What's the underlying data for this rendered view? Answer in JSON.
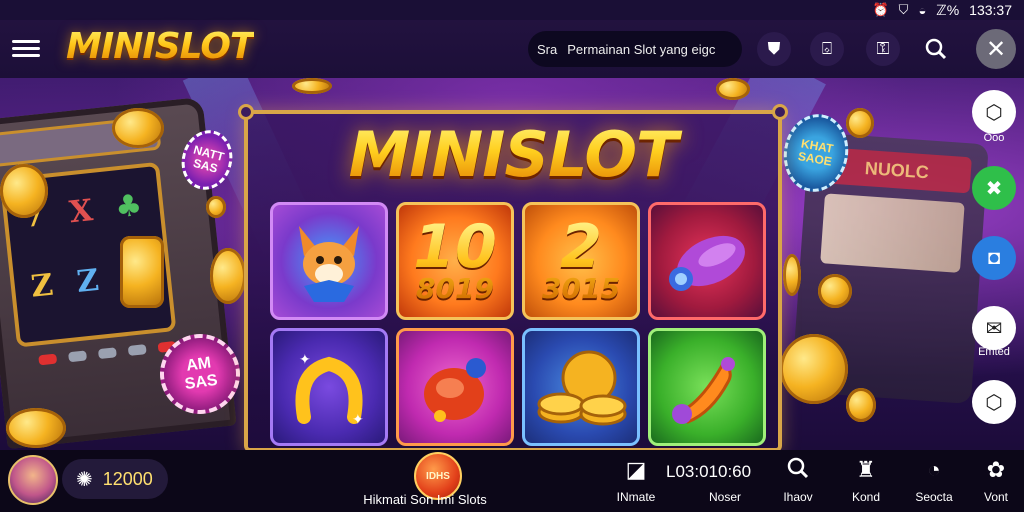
{
  "status_bar": {
    "icons": [
      "alarm-icon",
      "shield-icon",
      "wifi-icon",
      "battery-icon"
    ],
    "battery": "ℤ%",
    "time": "133:37"
  },
  "header": {
    "logo": "MINISLOT",
    "search": {
      "prefix": "Sra",
      "text": "Permainan Slot yang eigc"
    },
    "icons": [
      "badge-icon",
      "shop-icon",
      "key-icon",
      "search-icon",
      "close-icon"
    ]
  },
  "main": {
    "title": "MINISLOT",
    "tiles": [
      {
        "name": "fox-tile",
        "icon": "fox-icon",
        "colors": [
          "#a64cd6",
          "#3b67d8"
        ]
      },
      {
        "name": "number-tile-1",
        "top": "10",
        "bottom": "8019",
        "colors": [
          "#ff8a1e",
          "#c0380a"
        ]
      },
      {
        "name": "number-tile-2",
        "top": "2",
        "bottom": "3015",
        "colors": [
          "#ffb21e",
          "#c0500a"
        ]
      },
      {
        "name": "rocket-tile",
        "icon": "rocket-icon",
        "colors": [
          "#c4245a",
          "#5a0f3a"
        ]
      },
      {
        "name": "horseshoe-tile",
        "icon": "horseshoe-icon",
        "colors": [
          "#6a3acb",
          "#3a1f8a"
        ]
      },
      {
        "name": "gem-tile",
        "icon": "gem-icon",
        "colors": [
          "#d23ab0",
          "#7a1a7a"
        ]
      },
      {
        "name": "coin-stack-tile",
        "icon": "coin-stack-icon",
        "colors": [
          "#3a6ad0",
          "#1c2f7a"
        ]
      },
      {
        "name": "horn-tile",
        "icon": "horn-icon",
        "colors": [
          "#4cc23a",
          "#1a6a1e"
        ]
      }
    ],
    "left_chip": "AM\nSAS",
    "top_chip": "NATT\nSAS",
    "right_chip": "KHAT\nSAOE",
    "right_machine_label": "NUOLC"
  },
  "side_buttons": [
    {
      "name": "side-button-1",
      "icon": "hexagon-icon",
      "label": "Ooo",
      "bg": "#ffffff",
      "fg": "#222222"
    },
    {
      "name": "side-button-2",
      "icon": "x-icon",
      "label": "",
      "bg": "#2fbf4a",
      "fg": "#ffffff"
    },
    {
      "name": "side-button-3",
      "icon": "bag-icon",
      "label": "",
      "bg": "#2a7ee0",
      "fg": "#ffffff"
    },
    {
      "name": "side-button-4",
      "icon": "inbox-icon",
      "label": "Emted",
      "bg": "#ffffff",
      "fg": "#222222"
    },
    {
      "name": "side-button-5",
      "icon": "hexagon-icon",
      "label": "",
      "bg": "#ffffff",
      "fg": "#222222"
    }
  ],
  "bottom_bar": {
    "balance": "12000",
    "center_button": "IDHS",
    "center_label": "Hikmati Son Imi Slots",
    "timer": "L03:010:60",
    "nav": [
      {
        "name": "nav-inmate",
        "icon": "bookmark-icon",
        "label": "INmate"
      },
      {
        "name": "nav-noser",
        "icon": "",
        "label": "Noser"
      },
      {
        "name": "nav-ihaov",
        "icon": "search-icon",
        "label": "Ihaov"
      },
      {
        "name": "nav-kond",
        "icon": "trophy-icon",
        "label": "Kond"
      },
      {
        "name": "nav-seocta",
        "icon": "clock-icon",
        "label": "Seocta"
      },
      {
        "name": "nav-vont",
        "icon": "flower-icon",
        "label": "Vont"
      }
    ]
  },
  "colors": {
    "accent_gold": "#ffc61a",
    "background": "#1a0f36"
  }
}
